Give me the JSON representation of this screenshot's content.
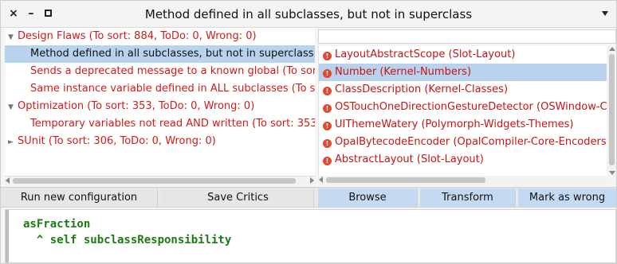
{
  "window": {
    "title": "Method defined in all subclasses, but not in superclass",
    "close_glyph": "×",
    "minimize_glyph": "–"
  },
  "tree": {
    "items": [
      {
        "label": "Design Flaws (To sort: 884, ToDo: 0, Wrong: 0)",
        "arrow": "▼",
        "level": 0,
        "selected": false
      },
      {
        "label": "Method defined in all subclasses, but not in superclass",
        "arrow": "",
        "level": 1,
        "selected": true
      },
      {
        "label": "Sends a deprecated message to a known global (To sort",
        "arrow": "",
        "level": 1,
        "selected": false
      },
      {
        "label": "Same instance variable defined in ALL subclasses (To so",
        "arrow": "",
        "level": 1,
        "selected": false
      },
      {
        "label": "Optimization (To sort: 353, ToDo: 0, Wrong: 0)",
        "arrow": "▼",
        "level": 0,
        "selected": false
      },
      {
        "label": "Temporary variables not read AND written (To sort: 353",
        "arrow": "",
        "level": 1,
        "selected": false
      },
      {
        "label": "SUnit (To sort: 306, ToDo: 0, Wrong: 0)",
        "arrow": "►",
        "level": 0,
        "selected": false
      }
    ]
  },
  "results": {
    "filter_value": "",
    "partial_top": "… … (Slot-Layout) … …",
    "items": [
      {
        "label": "LayoutAbstractScope (Slot-Layout)",
        "selected": false
      },
      {
        "label": "Number (Kernel-Numbers)",
        "selected": true
      },
      {
        "label": "ClassDescription (Kernel-Classes)",
        "selected": false
      },
      {
        "label": "OSTouchOneDirectionGestureDetector (OSWindow-Cor",
        "selected": false
      },
      {
        "label": "UIThemeWatery (Polymorph-Widgets-Themes)",
        "selected": false
      },
      {
        "label": "OpalBytecodeEncoder (OpalCompiler-Core-Encoders)",
        "selected": false
      },
      {
        "label": "AbstractLayout (Slot-Layout)",
        "selected": false
      }
    ],
    "icon_glyph": "!"
  },
  "buttons": {
    "run_new_configuration": "Run new configuration",
    "save_critics": "Save Critics",
    "browse": "Browse",
    "transform": "Transform",
    "mark_as_wrong": "Mark as wrong"
  },
  "code": {
    "line1": "asFraction",
    "line2": "  ^ self subclassResponsibility"
  },
  "colors": {
    "critic_red": "#d21a1a",
    "selection_blue": "#b9d3ef",
    "code_green": "#1c7a15"
  }
}
